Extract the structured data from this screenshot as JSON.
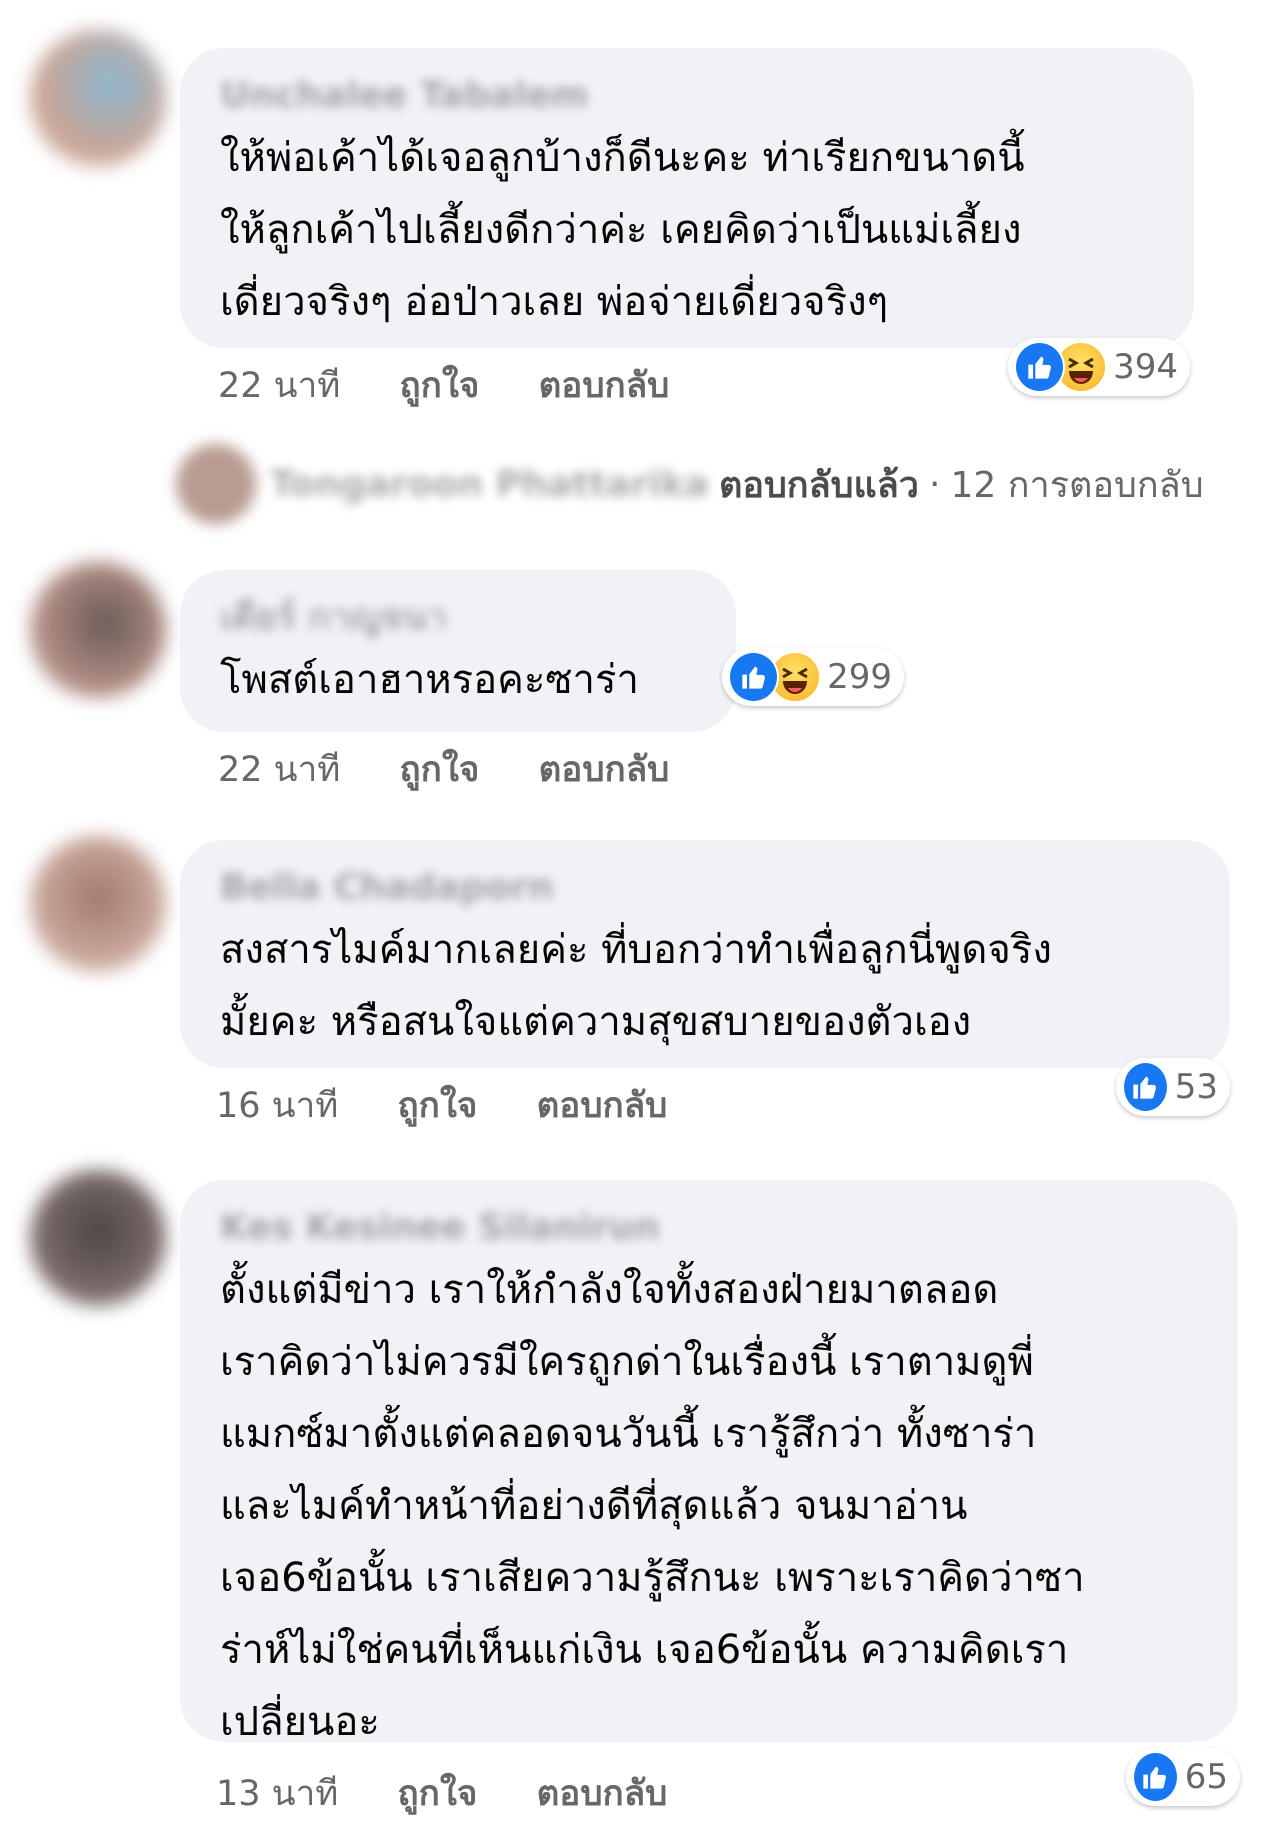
{
  "comments": [
    {
      "author": "Unchalee Tabalem",
      "text": "ให้พ่อเค้าได้เจอลูกบ้างก็ดีนะคะ ท่าเรียกขนาดนี้\nให้ลูกเค้าไปเลี้ยงดีกว่าค่ะ เคยคิดว่าเป็นแม่เลี้ยง\nเดี่ยวจริงๆ อ่อป่าวเลย พ่อจ่ายเดี่ยวจริงๆ",
      "time": "22 นาที",
      "like_label": "ถูกใจ",
      "reply_label": "ตอบกลับ",
      "reaction_count": "394",
      "reactions": [
        "like-icon",
        "haha-icon"
      ]
    },
    {
      "author": "เตียร์ กาญจนา",
      "text": "โพสต์เอาฮาหรอคะซาร่า",
      "time": "22 นาที",
      "like_label": "ถูกใจ",
      "reply_label": "ตอบกลับ",
      "reaction_count": "299",
      "reactions": [
        "like-icon",
        "haha-icon"
      ]
    },
    {
      "author": "Bella Chadaporn",
      "text": "สงสารไมค์มากเลยค่ะ ที่บอกว่าทำเพื่อลูกนี่พูดจริง\nมั้ยคะ หรือสนใจแต่ความสุขสบายของตัวเอง",
      "time": "16 นาที",
      "like_label": "ถูกใจ",
      "reply_label": "ตอบกลับ",
      "reaction_count": "53",
      "reactions": [
        "like-icon"
      ]
    },
    {
      "author": "Kes Kesinee Silanirun",
      "text": "ตั้งแต่มีข่าว เราให้กำลังใจทั้งสองฝ่ายมาตลอด\nเราคิดว่าไม่ควรมีใครถูกด่าในเรื่องนี้ เราตามดูพี่\nแมกซ์มาตั้งแต่คลอดจนวันนี้ เรารู้สึกว่า ทั้งซาร่า\nและไมค์ทำหน้าที่อย่างดีที่สุดแล้ว จนมาอ่าน\nเจอ6ข้อนั้น เราเสียความรู้สึกนะ เพราะเราคิดว่าซา\nร่าห์ไม่ใช่คนที่เห็นแก่เงิน เจอ6ข้อนั้น ความคิดเรา\nเปลี่ยนอะ",
      "time": "13 นาที",
      "like_label": "ถูกใจ",
      "reply_label": "ตอบกลับ",
      "reaction_count": "65",
      "reactions": [
        "like-icon"
      ]
    }
  ],
  "reply_thread": {
    "name": "Tongaroon Phattarika",
    "replied_label": "ตอบกลับแล้ว",
    "separator": "·",
    "replies_count": "12 การตอบกลับ"
  },
  "colors": {
    "bubble": "#f0f2f5",
    "meta_text": "#65676b",
    "like_blue": "#1877f2"
  }
}
